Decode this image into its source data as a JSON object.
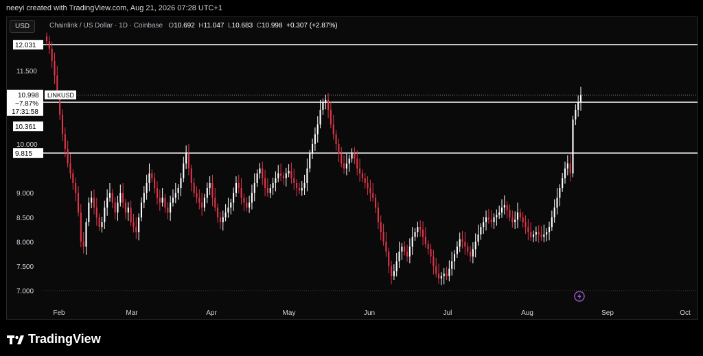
{
  "header": {
    "created_text": "neeyi created with TradingView.com, Aug 21, 2026 07:28 UTC+1"
  },
  "toolbar": {
    "currency_label": "USD"
  },
  "legend": {
    "symbol_desc": "Chainlink / US Dollar · 1D · Coinbase",
    "o_label": "O",
    "o_value": "10.692",
    "h_label": "H",
    "h_value": "11.047",
    "l_label": "L",
    "l_value": "10.683",
    "c_label": "C",
    "c_value": "10.998",
    "change": "+0.307 (+2.87%)"
  },
  "brand": {
    "name": "TradingView"
  },
  "colors": {
    "up": "#ffffff",
    "down": "#e0354a",
    "line": "#ffffff",
    "grid": "#2a2a2a"
  },
  "chart_data": {
    "type": "candlestick",
    "symbol": "LINKUSD",
    "ylim": [
      6.8,
      12.3
    ],
    "y_ticks": [
      "11.500",
      "10.000",
      "9.000",
      "8.500",
      "8.000",
      "7.500",
      "7.000"
    ],
    "x_ticks": [
      "Feb",
      "Mar",
      "Apr",
      "May",
      "Jun",
      "Jul",
      "Aug",
      "Sep",
      "Oct"
    ],
    "horizontal_lines": [
      12.031,
      10.855,
      9.815,
      10.998
    ],
    "price_labels": [
      {
        "text": "12.031",
        "value": 12.031
      },
      {
        "text": "10.855",
        "value": 10.855
      },
      {
        "text": "10.361",
        "value": 10.361
      },
      {
        "text": "9.815",
        "value": 9.815
      }
    ],
    "current": {
      "price": "10.998",
      "change_pct": "−7.87%",
      "countdown": "17:31:58",
      "tag": "LINKUSD"
    },
    "closes": [
      12.1,
      11.95,
      11.7,
      11.4,
      11.0,
      10.6,
      10.2,
      9.9,
      9.6,
      9.4,
      9.2,
      9.0,
      8.6,
      8.0,
      7.9,
      8.4,
      8.8,
      8.9,
      8.7,
      8.5,
      8.3,
      8.4,
      8.7,
      8.9,
      9.0,
      8.8,
      8.6,
      8.8,
      9.0,
      8.8,
      8.6,
      8.7,
      8.4,
      8.3,
      8.2,
      8.5,
      8.8,
      9.0,
      9.2,
      9.4,
      9.3,
      9.1,
      8.9,
      8.8,
      8.9,
      8.7,
      8.6,
      8.8,
      8.9,
      9.0,
      9.1,
      9.3,
      9.6,
      9.8,
      9.5,
      9.2,
      9.0,
      8.9,
      8.8,
      8.7,
      8.9,
      9.1,
      9.2,
      8.9,
      8.7,
      8.5,
      8.4,
      8.5,
      8.6,
      8.7,
      8.8,
      9.0,
      9.2,
      9.1,
      8.9,
      8.8,
      8.7,
      8.8,
      9.0,
      9.2,
      9.4,
      9.5,
      9.3,
      9.1,
      9.0,
      9.1,
      9.2,
      9.3,
      9.4,
      9.35,
      9.3,
      9.4,
      9.45,
      9.3,
      9.2,
      9.1,
      9.05,
      9.1,
      9.2,
      9.5,
      9.8,
      10.0,
      10.2,
      10.4,
      10.7,
      10.85,
      10.9,
      10.7,
      10.4,
      10.2,
      10.0,
      9.8,
      9.6,
      9.5,
      9.6,
      9.7,
      9.8,
      9.7,
      9.5,
      9.4,
      9.3,
      9.2,
      9.1,
      9.0,
      8.9,
      8.7,
      8.4,
      8.2,
      8.0,
      7.8,
      7.5,
      7.3,
      7.4,
      7.6,
      7.8,
      7.9,
      7.8,
      7.7,
      7.9,
      8.1,
      8.2,
      8.3,
      8.25,
      8.1,
      7.95,
      7.85,
      7.7,
      7.5,
      7.35,
      7.25,
      7.3,
      7.35,
      7.3,
      7.45,
      7.6,
      7.75,
      7.9,
      8.05,
      8.0,
      7.9,
      7.8,
      7.7,
      7.85,
      8.0,
      8.15,
      8.3,
      8.4,
      8.5,
      8.45,
      8.4,
      8.5,
      8.55,
      8.6,
      8.7,
      8.75,
      8.65,
      8.5,
      8.4,
      8.45,
      8.6,
      8.5,
      8.4,
      8.3,
      8.2,
      8.1,
      8.15,
      8.2,
      8.15,
      8.1,
      8.15,
      8.2,
      8.3,
      8.5,
      8.7,
      8.9,
      9.1,
      9.3,
      9.5,
      9.6,
      9.4,
      10.5,
      10.7,
      10.85,
      10.998
    ]
  }
}
